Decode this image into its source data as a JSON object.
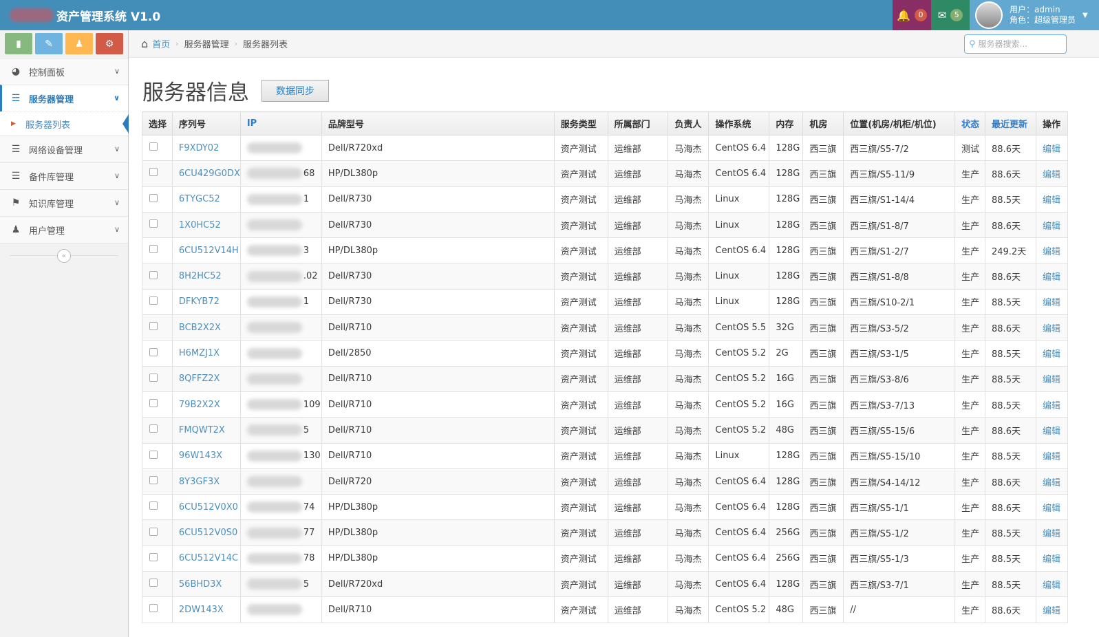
{
  "app": {
    "title": "资产管理系统 V1.0"
  },
  "header": {
    "notifications_count": "0",
    "messages_count": "5",
    "user_line": "用户：admin",
    "role_line": "角色：超级管理员"
  },
  "sidebar": {
    "shortcuts": [
      "chart-icon",
      "pencil-icon",
      "group-icon",
      "cogs-icon"
    ],
    "items": [
      {
        "label": "控制面板",
        "icon": "dashboard-icon"
      },
      {
        "label": "服务器管理",
        "icon": "list-icon"
      },
      {
        "label": "网络设备管理",
        "icon": "list-icon"
      },
      {
        "label": "备件库管理",
        "icon": "list-icon"
      },
      {
        "label": "知识库管理",
        "icon": "bookmark-icon"
      },
      {
        "label": "用户管理",
        "icon": "user-icon"
      }
    ],
    "sub_item": "服务器列表"
  },
  "breadcrumb": {
    "home": "首页",
    "level1": "服务器管理",
    "level2": "服务器列表"
  },
  "search": {
    "placeholder": "服务器搜索..."
  },
  "page": {
    "title": "服务器信息",
    "sync_button": "数据同步"
  },
  "table": {
    "headers": [
      "选择",
      "序列号",
      "IP",
      "品牌型号",
      "服务类型",
      "所属部门",
      "负责人",
      "操作系统",
      "内存",
      "机房",
      "位置(机房/机柜/机位)",
      "状态",
      "最近更新",
      "操作"
    ],
    "rows": [
      {
        "sn": "F9XDY02",
        "ip": "",
        "model": "Dell/R720xd",
        "svc": "资产测试",
        "dept": "运维部",
        "owner": "马海杰",
        "os": "CentOS 6.4",
        "mem": "128G",
        "room": "西三旗",
        "loc": "西三旗/S5-7/2",
        "status": "测试",
        "updated": "88.6天",
        "action": "编辑"
      },
      {
        "sn": "6CU429G0DX",
        "ip": "68",
        "model": "HP/DL380p",
        "svc": "资产测试",
        "dept": "运维部",
        "owner": "马海杰",
        "os": "CentOS 6.4",
        "mem": "128G",
        "room": "西三旗",
        "loc": "西三旗/S5-11/9",
        "status": "生产",
        "updated": "88.6天",
        "action": "编辑"
      },
      {
        "sn": "6TYGC52",
        "ip": "1",
        "model": "Dell/R730",
        "svc": "资产测试",
        "dept": "运维部",
        "owner": "马海杰",
        "os": "Linux",
        "mem": "128G",
        "room": "西三旗",
        "loc": "西三旗/S1-14/4",
        "status": "生产",
        "updated": "88.5天",
        "action": "编辑"
      },
      {
        "sn": "1X0HC52",
        "ip": "",
        "model": "Dell/R730",
        "svc": "资产测试",
        "dept": "运维部",
        "owner": "马海杰",
        "os": "Linux",
        "mem": "128G",
        "room": "西三旗",
        "loc": "西三旗/S1-8/7",
        "status": "生产",
        "updated": "88.6天",
        "action": "编辑"
      },
      {
        "sn": "6CU512V14H",
        "ip": "3",
        "model": "HP/DL380p",
        "svc": "资产测试",
        "dept": "运维部",
        "owner": "马海杰",
        "os": "CentOS 6.4",
        "mem": "128G",
        "room": "西三旗",
        "loc": "西三旗/S1-2/7",
        "status": "生产",
        "updated": "249.2天",
        "action": "编辑"
      },
      {
        "sn": "8H2HC52",
        "ip": ".02",
        "model": "Dell/R730",
        "svc": "资产测试",
        "dept": "运维部",
        "owner": "马海杰",
        "os": "Linux",
        "mem": "128G",
        "room": "西三旗",
        "loc": "西三旗/S1-8/8",
        "status": "生产",
        "updated": "88.6天",
        "action": "编辑"
      },
      {
        "sn": "DFKYB72",
        "ip": "1",
        "model": "Dell/R730",
        "svc": "资产测试",
        "dept": "运维部",
        "owner": "马海杰",
        "os": "Linux",
        "mem": "128G",
        "room": "西三旗",
        "loc": "西三旗/S10-2/1",
        "status": "生产",
        "updated": "88.5天",
        "action": "编辑"
      },
      {
        "sn": "BCB2X2X",
        "ip": "",
        "model": "Dell/R710",
        "svc": "资产测试",
        "dept": "运维部",
        "owner": "马海杰",
        "os": "CentOS 5.5",
        "mem": "32G",
        "room": "西三旗",
        "loc": "西三旗/S3-5/2",
        "status": "生产",
        "updated": "88.6天",
        "action": "编辑"
      },
      {
        "sn": "H6MZJ1X",
        "ip": "",
        "model": "Dell/2850",
        "svc": "资产测试",
        "dept": "运维部",
        "owner": "马海杰",
        "os": "CentOS 5.2",
        "mem": "2G",
        "room": "西三旗",
        "loc": "西三旗/S3-1/5",
        "status": "生产",
        "updated": "88.5天",
        "action": "编辑"
      },
      {
        "sn": "8QFFZ2X",
        "ip": "",
        "model": "Dell/R710",
        "svc": "资产测试",
        "dept": "运维部",
        "owner": "马海杰",
        "os": "CentOS 5.2",
        "mem": "16G",
        "room": "西三旗",
        "loc": "西三旗/S3-8/6",
        "status": "生产",
        "updated": "88.5天",
        "action": "编辑"
      },
      {
        "sn": "79B2X2X",
        "ip": "109",
        "model": "Dell/R710",
        "svc": "资产测试",
        "dept": "运维部",
        "owner": "马海杰",
        "os": "CentOS 5.2",
        "mem": "16G",
        "room": "西三旗",
        "loc": "西三旗/S3-7/13",
        "status": "生产",
        "updated": "88.5天",
        "action": "编辑"
      },
      {
        "sn": "FMQWT2X",
        "ip": "5",
        "model": "Dell/R710",
        "svc": "资产测试",
        "dept": "运维部",
        "owner": "马海杰",
        "os": "CentOS 5.2",
        "mem": "48G",
        "room": "西三旗",
        "loc": "西三旗/S5-15/6",
        "status": "生产",
        "updated": "88.6天",
        "action": "编辑"
      },
      {
        "sn": "96W143X",
        "ip": "130",
        "model": "Dell/R710",
        "svc": "资产测试",
        "dept": "运维部",
        "owner": "马海杰",
        "os": "Linux",
        "mem": "128G",
        "room": "西三旗",
        "loc": "西三旗/S5-15/10",
        "status": "生产",
        "updated": "88.5天",
        "action": "编辑"
      },
      {
        "sn": "8Y3GF3X",
        "ip": "",
        "model": "Dell/R720",
        "svc": "资产测试",
        "dept": "运维部",
        "owner": "马海杰",
        "os": "CentOS 6.4",
        "mem": "128G",
        "room": "西三旗",
        "loc": "西三旗/S4-14/12",
        "status": "生产",
        "updated": "88.6天",
        "action": "编辑"
      },
      {
        "sn": "6CU512V0X0",
        "ip": "74",
        "model": "HP/DL380p",
        "svc": "资产测试",
        "dept": "运维部",
        "owner": "马海杰",
        "os": "CentOS 6.4",
        "mem": "128G",
        "room": "西三旗",
        "loc": "西三旗/S5-1/1",
        "status": "生产",
        "updated": "88.6天",
        "action": "编辑"
      },
      {
        "sn": "6CU512V0S0",
        "ip": "77",
        "model": "HP/DL380p",
        "svc": "资产测试",
        "dept": "运维部",
        "owner": "马海杰",
        "os": "CentOS 6.4",
        "mem": "256G",
        "room": "西三旗",
        "loc": "西三旗/S5-1/2",
        "status": "生产",
        "updated": "88.5天",
        "action": "编辑"
      },
      {
        "sn": "6CU512V14C",
        "ip": "78",
        "model": "HP/DL380p",
        "svc": "资产测试",
        "dept": "运维部",
        "owner": "马海杰",
        "os": "CentOS 6.4",
        "mem": "256G",
        "room": "西三旗",
        "loc": "西三旗/S5-1/3",
        "status": "生产",
        "updated": "88.5天",
        "action": "编辑"
      },
      {
        "sn": "56BHD3X",
        "ip": "5",
        "model": "Dell/R720xd",
        "svc": "资产测试",
        "dept": "运维部",
        "owner": "马海杰",
        "os": "CentOS 6.4",
        "mem": "128G",
        "room": "西三旗",
        "loc": "西三旗/S3-7/1",
        "status": "生产",
        "updated": "88.5天",
        "action": "编辑"
      },
      {
        "sn": "2DW143X",
        "ip": "",
        "model": "Dell/R710",
        "svc": "资产测试",
        "dept": "运维部",
        "owner": "马海杰",
        "os": "CentOS 5.2",
        "mem": "48G",
        "room": "西三旗",
        "loc": "//",
        "status": "生产",
        "updated": "88.6天",
        "action": "编辑"
      }
    ]
  },
  "colors": {
    "navbar": "#438eb9",
    "link": "#4c8fbd",
    "bell_bg": "#892e65",
    "mail_bg": "#2e8965",
    "user_bg": "#62a8d1"
  }
}
